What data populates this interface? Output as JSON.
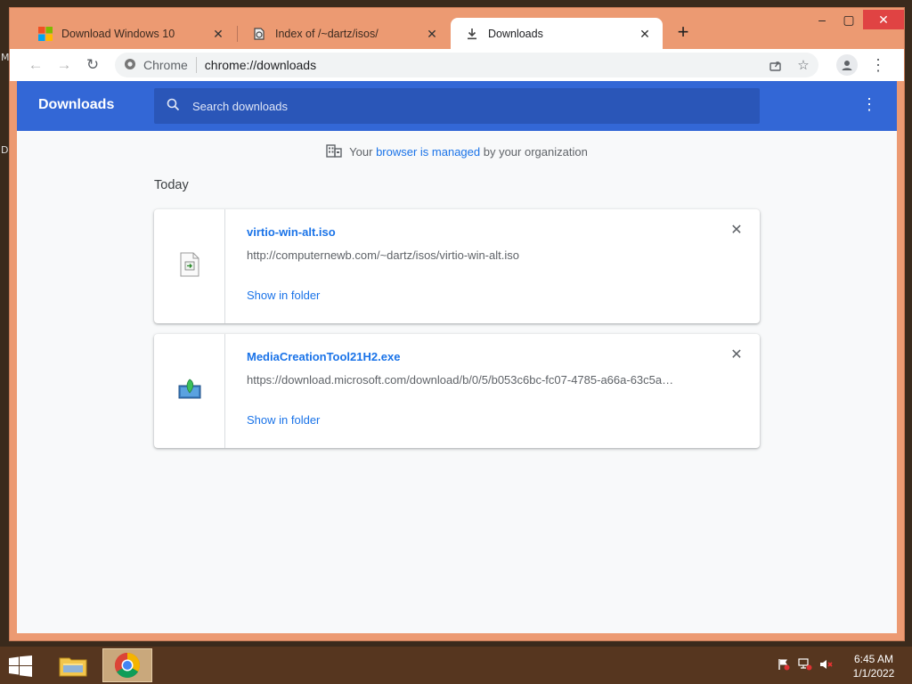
{
  "window": {
    "tabs": [
      {
        "title": "Download Windows 10",
        "icon": "windows-logo-icon",
        "active": false
      },
      {
        "title": "Index of /~dartz/isos/",
        "icon": "page-icon",
        "active": false
      },
      {
        "title": "Downloads",
        "icon": "download-icon",
        "active": true
      }
    ],
    "tab_close_glyph": "✕",
    "new_tab_glyph": "+"
  },
  "toolbar": {
    "omnibox_chip": "Chrome",
    "url": "chrome://downloads"
  },
  "downloads_page": {
    "title": "Downloads",
    "search_placeholder": "Search downloads",
    "managed_notice": {
      "prefix": "Your ",
      "link": "browser is managed",
      "suffix": " by your organization"
    },
    "section_label": "Today",
    "items": [
      {
        "filename": "virtio-win-alt.iso",
        "url": "http://computernewb.com/~dartz/isos/virtio-win-alt.iso",
        "action": "Show in folder",
        "icon": "iso-file-icon"
      },
      {
        "filename": "MediaCreationTool21H2.exe",
        "url": "https://download.microsoft.com/download/b/0/5/b053c6bc-fc07-4785-a66a-63c5a…",
        "action": "Show in folder",
        "icon": "installer-exe-icon"
      }
    ]
  },
  "taskbar": {
    "time": "6:45 AM",
    "date": "1/1/2022"
  },
  "colors": {
    "accent": "#3367d6",
    "link": "#1a73e8",
    "frame": "#ec9a72",
    "taskbar": "#56361f"
  }
}
